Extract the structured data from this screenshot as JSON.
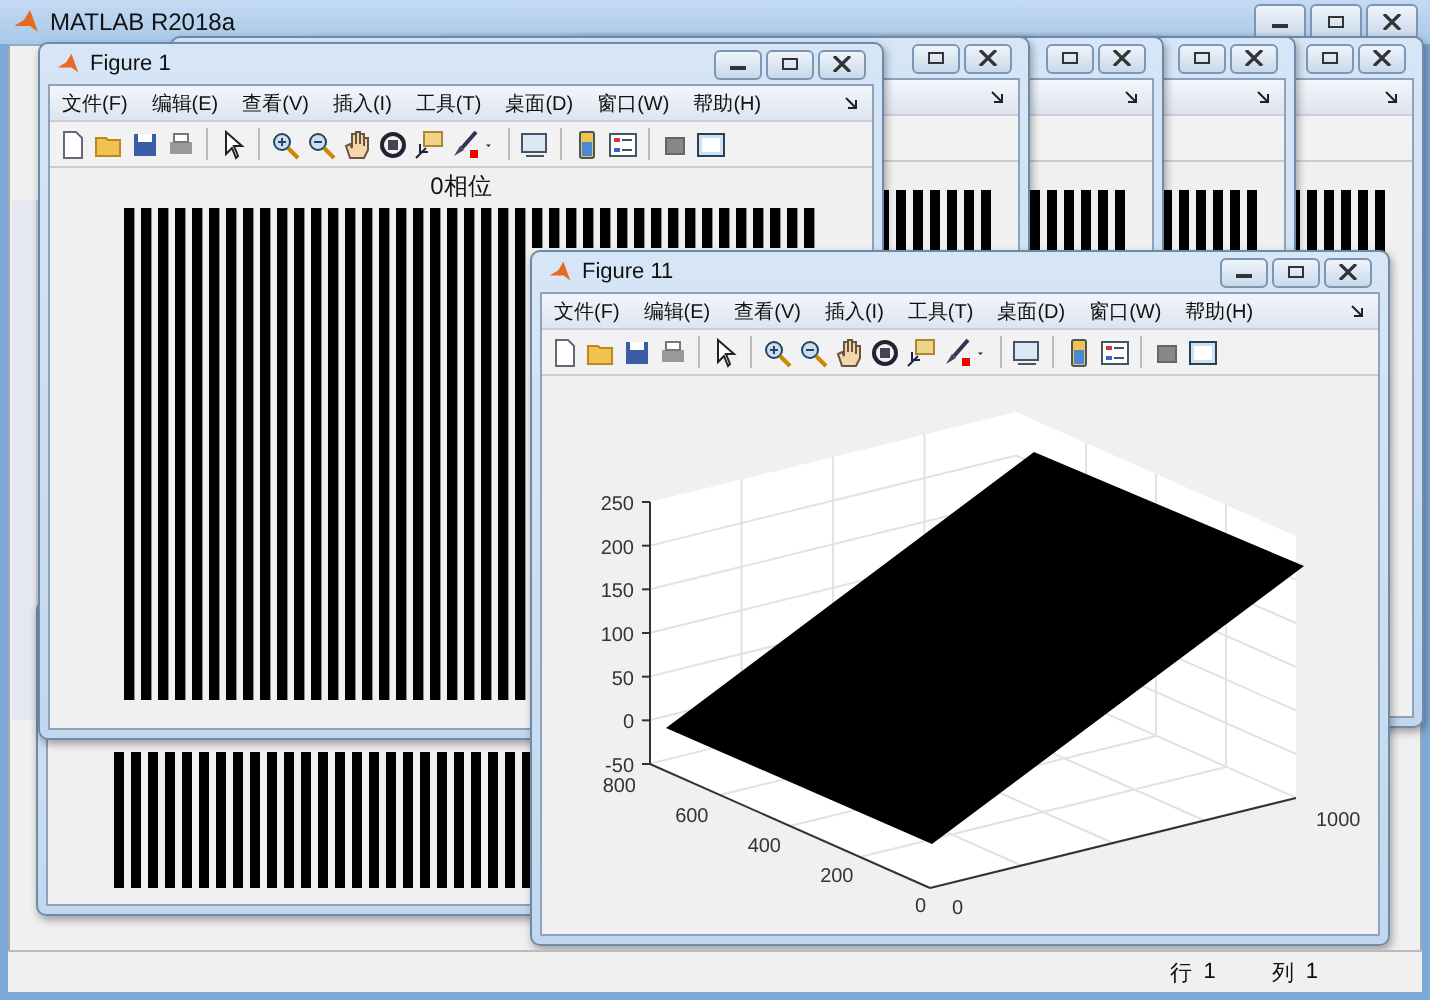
{
  "main_window": {
    "title": "MATLAB R2018a"
  },
  "figures": [
    {
      "title": "Figure 1",
      "menu": [
        "文件(F)",
        "编辑(E)",
        "查看(V)",
        "插入(I)",
        "工具(T)",
        "桌面(D)",
        "窗口(W)",
        "帮助(H)"
      ],
      "plot": {
        "kind": "stripes",
        "title": "0相位"
      }
    },
    {
      "title": "Figure 11",
      "menu": [
        "文件(F)",
        "编辑(E)",
        "查看(V)",
        "插入(I)",
        "工具(T)",
        "桌面(D)",
        "窗口(W)",
        "帮助(H)"
      ],
      "plot": {
        "kind": "surface",
        "z_ticks": [
          "250",
          "200",
          "150",
          "100",
          "50",
          "0",
          "-50"
        ],
        "y_ticks": [
          "800",
          "600",
          "400",
          "200",
          "0"
        ],
        "x_ticks": [
          "0",
          "1000"
        ]
      }
    }
  ],
  "status_bar": {
    "row_label": "行",
    "row": "1",
    "column_label": "列",
    "column": "1"
  }
}
